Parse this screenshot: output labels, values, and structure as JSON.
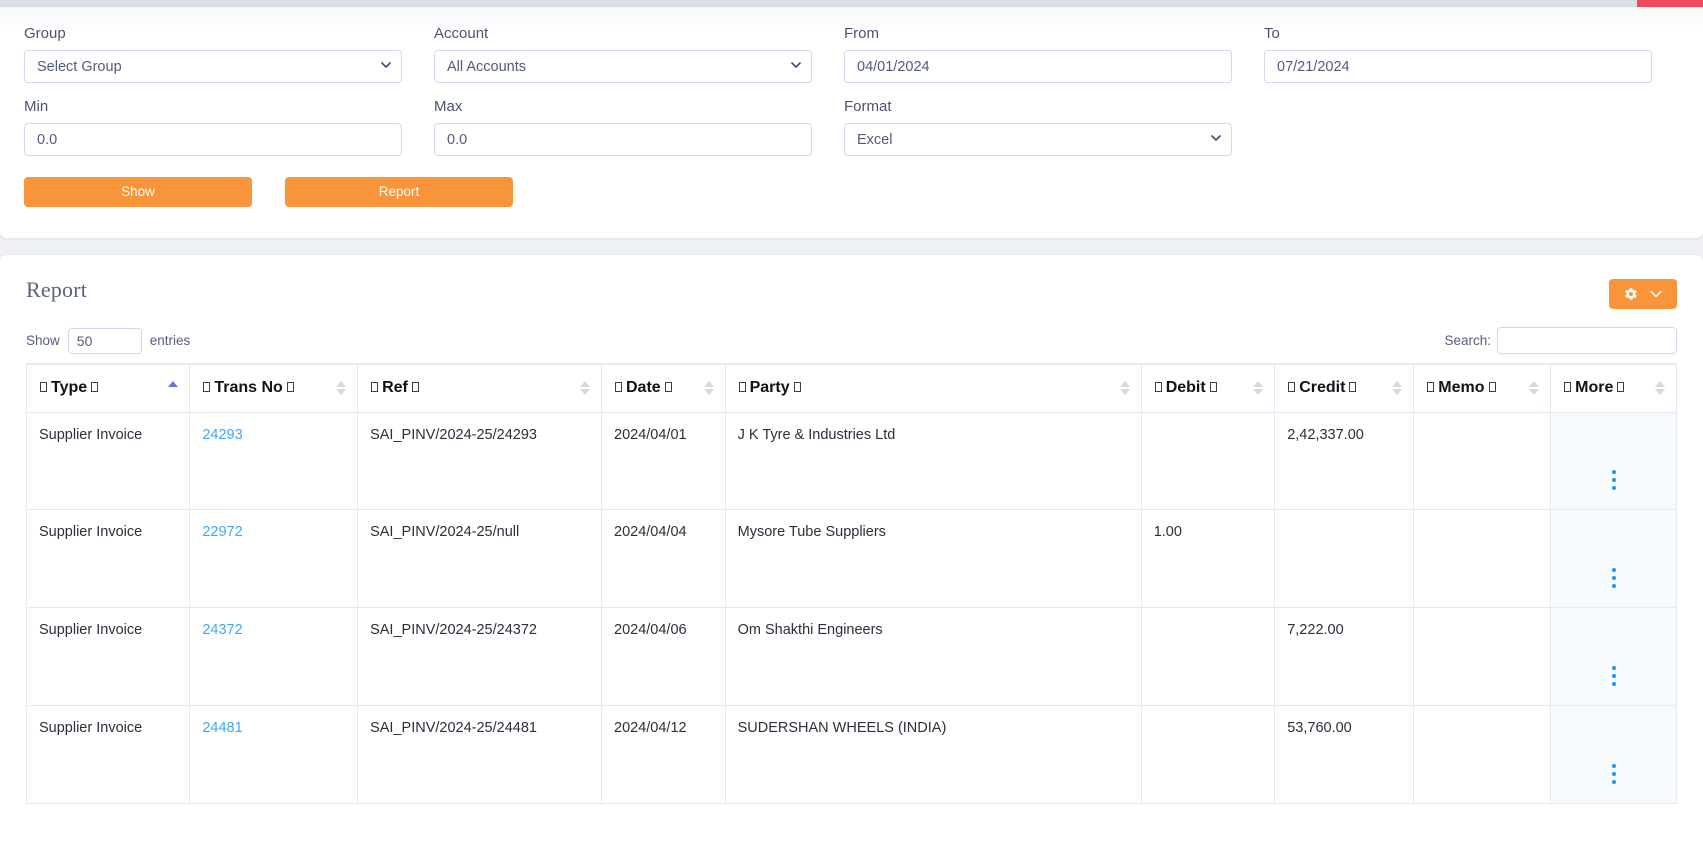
{
  "colors": {
    "accent_orange": "#f9943b",
    "link_blue": "#3da8f5",
    "sort_active": "#6b73e0",
    "top_strip_red": "#f04a5e",
    "page_bg": "#eef0f5"
  },
  "filters": {
    "group": {
      "label": "Group",
      "value": "Select Group",
      "options": [
        "Select Group"
      ]
    },
    "account": {
      "label": "Account",
      "value": "All Accounts",
      "options": [
        "All Accounts"
      ]
    },
    "from": {
      "label": "From",
      "value": "04/01/2024"
    },
    "to": {
      "label": "To",
      "value": "07/21/2024"
    },
    "min": {
      "label": "Min",
      "value": "0.0"
    },
    "max": {
      "label": "Max",
      "value": "0.0"
    },
    "format": {
      "label": "Format",
      "value": "Excel",
      "options": [
        "Excel"
      ]
    },
    "show_button": "Show",
    "report_button": "Report"
  },
  "report": {
    "title": "Report",
    "settings_button": {
      "icon": "gear-icon",
      "chevron": "chevron-down-icon"
    },
    "length": {
      "prefix": "Show",
      "value": "50",
      "suffix": "entries"
    },
    "search": {
      "label": "Search:",
      "value": "",
      "placeholder": ""
    },
    "columns": [
      {
        "label": "Type",
        "sort": "asc"
      },
      {
        "label": "Trans No",
        "sort": "none"
      },
      {
        "label": "Ref",
        "sort": "none"
      },
      {
        "label": "Date",
        "sort": "none"
      },
      {
        "label": "Party",
        "sort": "none"
      },
      {
        "label": "Debit",
        "sort": "none"
      },
      {
        "label": "Credit",
        "sort": "none"
      },
      {
        "label": "Memo",
        "sort": "none"
      },
      {
        "label": "More",
        "sort": "none"
      }
    ],
    "rows": [
      {
        "type": "Supplier Invoice",
        "trans_no": "24293",
        "ref": "SAI_PINV/2024-25/24293",
        "date": "2024/04/01",
        "party": "J K Tyre & Industries Ltd",
        "debit": "",
        "credit": "2,42,337.00",
        "memo": ""
      },
      {
        "type": "Supplier Invoice",
        "trans_no": "22972",
        "ref": "SAI_PINV/2024-25/null",
        "date": "2024/04/04",
        "party": "Mysore Tube Suppliers",
        "debit": "1.00",
        "credit": "",
        "memo": ""
      },
      {
        "type": "Supplier Invoice",
        "trans_no": "24372",
        "ref": "SAI_PINV/2024-25/24372",
        "date": "2024/04/06",
        "party": "Om Shakthi Engineers",
        "debit": "",
        "credit": "7,222.00",
        "memo": ""
      },
      {
        "type": "Supplier Invoice",
        "trans_no": "24481",
        "ref": "SAI_PINV/2024-25/24481",
        "date": "2024/04/12",
        "party": "SUDERSHAN WHEELS (INDIA)",
        "debit": "",
        "credit": "53,760.00",
        "memo": ""
      }
    ]
  }
}
